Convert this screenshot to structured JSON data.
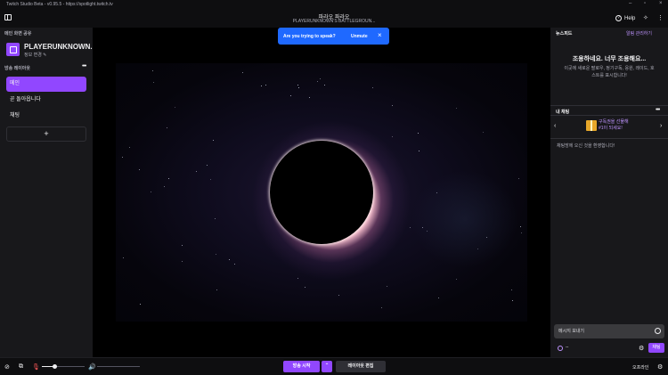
{
  "titlebar": {
    "title": "Twitch Studio Beta - v0.95.5 - https://spotlight.twitch.tv"
  },
  "header": {
    "scene": "파라오 파라오",
    "game": "PLAYERUNKNOWN'S BATTLEGROUN...",
    "help_label": "Help"
  },
  "left": {
    "share_title": "메인 화면 공유",
    "channel_name": "PLAYERUNKNOWN...",
    "channel_change": "정보 변경",
    "layouts_title": "방송 레이아웃",
    "layouts": [
      "메인",
      "곧 돌아옵니다",
      "채팅"
    ],
    "add_label": "+"
  },
  "toast": {
    "message": "Are you trying to speak?",
    "action": "Unmute",
    "close": "×"
  },
  "right": {
    "feed_title": "뉴스피드",
    "feed_manage": "알림 관리하기",
    "feed_empty_title": "조용하네요. 너무 조용해요...",
    "feed_empty_desc": "이곳에 새로운 팔로우, 정기구독, 응원, 레이드, 호스트를 표시합니다!",
    "chat_title": "내 채팅",
    "sub_line1": "구독권을 선물해",
    "sub_line2": "#1이 되세요!",
    "welcome": "채팅방에 오신 것을 환영합니다!",
    "input_placeholder": "메시지 보내기",
    "bits_value": "--",
    "send_label": "채팅"
  },
  "bottom": {
    "go_live": "방송 시작",
    "edit_layout": "레이아웃 편집",
    "status": "오프라인",
    "mic_level": 0.3,
    "volume_level": 0
  },
  "colors": {
    "accent": "#9147ff",
    "toast": "#1f69ff"
  }
}
